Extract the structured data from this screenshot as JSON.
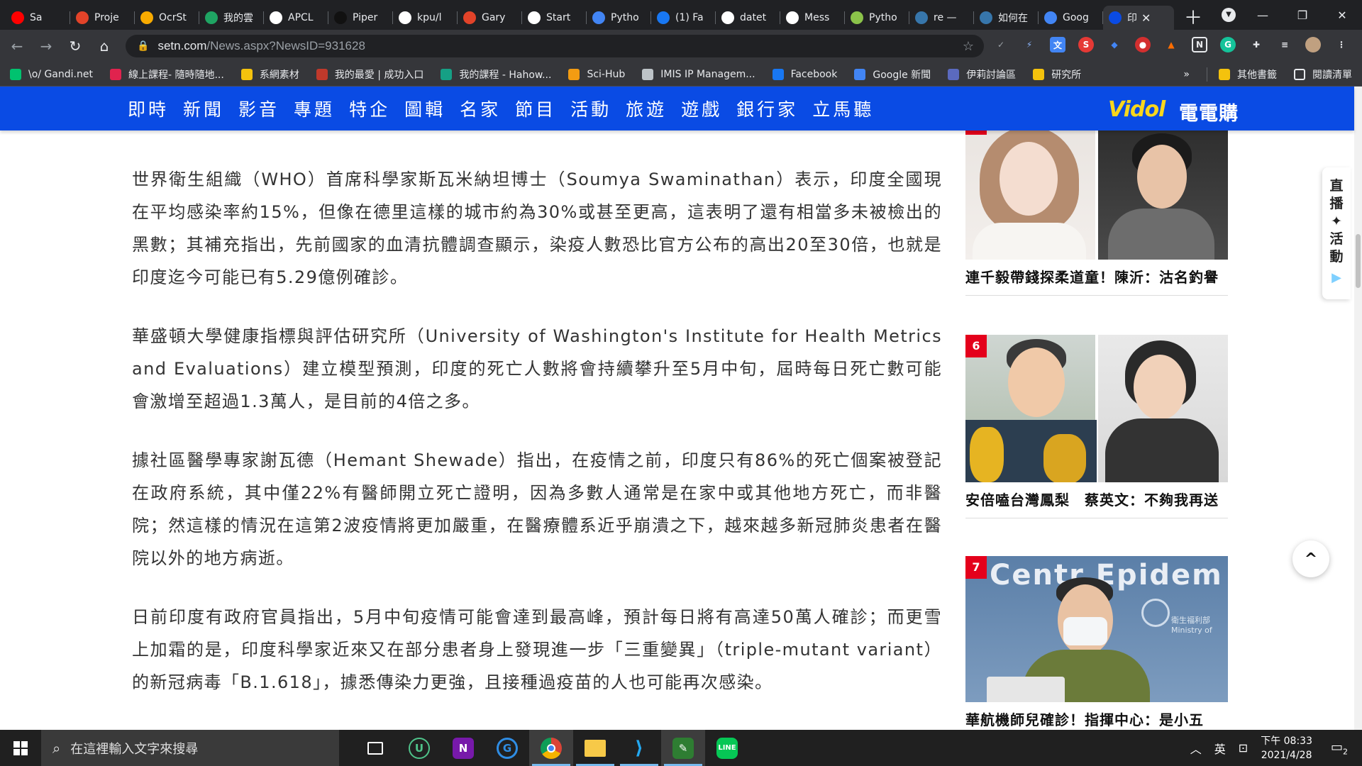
{
  "browser": {
    "tabs": [
      {
        "label": "Sa",
        "icon": "youtube-icon",
        "color": "#ff0000"
      },
      {
        "label": "Proje",
        "icon": "gitlab-icon",
        "color": "#e24329"
      },
      {
        "label": "OcrSt",
        "icon": "colab-icon",
        "color": "#f9ab00"
      },
      {
        "label": "我的雲",
        "icon": "drive-icon",
        "color": "#1fa463"
      },
      {
        "label": "APCL",
        "icon": "github-icon",
        "color": "#ffffff"
      },
      {
        "label": "Piper",
        "icon": "piper-icon",
        "color": "#111111"
      },
      {
        "label": "kpu/l",
        "icon": "github-icon",
        "color": "#ffffff"
      },
      {
        "label": "Gary",
        "icon": "gitlab-icon",
        "color": "#e24329"
      },
      {
        "label": "Start",
        "icon": "start-icon",
        "color": "#ffffff"
      },
      {
        "label": "Pytho",
        "icon": "python-icon",
        "color": "#4285f4"
      },
      {
        "label": "(1) Fa",
        "icon": "facebook-icon",
        "color": "#1877f2"
      },
      {
        "label": "datet",
        "icon": "google-icon",
        "color": "#ffffff"
      },
      {
        "label": "Mess",
        "icon": "google-icon",
        "color": "#ffffff"
      },
      {
        "label": "Pytho",
        "icon": "python-icon",
        "color": "#8bc34a"
      },
      {
        "label": "re —",
        "icon": "python-icon",
        "color": "#3776ab"
      },
      {
        "label": "如何在",
        "icon": "python-icon",
        "color": "#3776ab"
      },
      {
        "label": "Goog",
        "icon": "gnews-icon",
        "color": "#4285f4"
      },
      {
        "label": "印",
        "icon": "set-icon",
        "color": "#0a4be4",
        "active": true
      }
    ],
    "url_domain": "setn.com",
    "url_path": "/News.aspx?NewsID=931628",
    "bookmarks": [
      {
        "label": "\\o/ Gandi.net",
        "color": "#00c26f"
      },
      {
        "label": "線上課程- 隨時隨地...",
        "color": "#e0234e"
      },
      {
        "label": "系網素材",
        "color": "#f4c20d"
      },
      {
        "label": "我的最愛 | 成功入口",
        "color": "#c0392b"
      },
      {
        "label": "我的課程 - Hahow...",
        "color": "#16a085"
      },
      {
        "label": "Sci-Hub",
        "color": "#f39c12"
      },
      {
        "label": "IMIS IP Managem...",
        "color": "#bdc3c7"
      },
      {
        "label": "Facebook",
        "color": "#1877f2"
      },
      {
        "label": "Google 新聞",
        "color": "#4285f4"
      },
      {
        "label": "伊莉討論區",
        "color": "#5b6abf"
      },
      {
        "label": "研究所",
        "color": "#f4c20d"
      }
    ],
    "bookmarks_more": "»",
    "other_bookmarks": "其他書籤",
    "reading_list": "閱讀清單"
  },
  "site": {
    "nav": [
      "即時",
      "新聞",
      "影音",
      "專題",
      "特企",
      "圖輯",
      "名家",
      "節目",
      "活動",
      "旅遊",
      "遊戲",
      "銀行家",
      "立馬聽"
    ],
    "brand_vidol": "Vidol",
    "brand_shop": "電電購"
  },
  "article": {
    "paragraphs": [
      "世界衛生組織（WHO）首席科學家斯瓦米納坦博士（Soumya Swaminathan）表示，印度全國現在平均感染率約15%，但像在德里這樣的城市約為30%或甚至更高，這表明了還有相當多未被檢出的黑數；其補充指出，先前國家的血清抗體調查顯示，染疫人數恐比官方公布的高出20至30倍，也就是印度迄今可能已有5.29億例確診。",
      "華盛頓大學健康指標與評估研究所（University of Washington's Institute for Health Metrics and Evaluations）建立模型預測，印度的死亡人數將會持續攀升至5月中旬，屆時每日死亡數可能會激增至超過1.3萬人，是目前的4倍之多。",
      "據社區醫學專家謝瓦德（Hemant Shewade）指出，在疫情之前，印度只有86%的死亡個案被登記在政府系統，其中僅22%有醫師開立死亡證明，因為多數人通常是在家中或其他地方死亡，而非醫院；然這樣的情況在這第2波疫情將更加嚴重，在醫療體系近乎崩潰之下，越來越多新冠肺炎患者在醫院以外的地方病逝。",
      "日前印度有政府官員指出，5月中旬疫情可能會達到最高峰，預計每日將有高達50萬人確診；而更雪上加霜的是，印度科學家近來又在部分患者身上發現進一步「三重變異」（triple-mutant variant）的新冠病毒「B.1.618」，據悉傳染力更強，且接種過疫苗的人也可能再次感染。"
    ]
  },
  "sidebar": {
    "cards": [
      {
        "rank": "",
        "caption": "連千毅帶錢探柔道童！陳沂：沽名釣譽"
      },
      {
        "rank": "6",
        "caption": "安倍嗑台灣鳳梨　蔡英文：不夠我再送"
      },
      {
        "rank": "7",
        "caption": "華航機師兒確診！指揮中心：是小五"
      }
    ],
    "image7_sign": "Centr  Epidem",
    "image7_sub": "衛生福利部 Ministry of",
    "live_tab": [
      "直",
      "播",
      "✦",
      "活",
      "動"
    ]
  },
  "taskbar": {
    "search_placeholder": "在這裡輸入文字來搜尋",
    "ime": "英",
    "time": "下午 08:33",
    "date": "2021/4/28",
    "notifications": "2"
  },
  "colors": {
    "site_blue": "#0a4be4",
    "rank_red": "#e4001b",
    "chrome_dark": "#202124"
  }
}
